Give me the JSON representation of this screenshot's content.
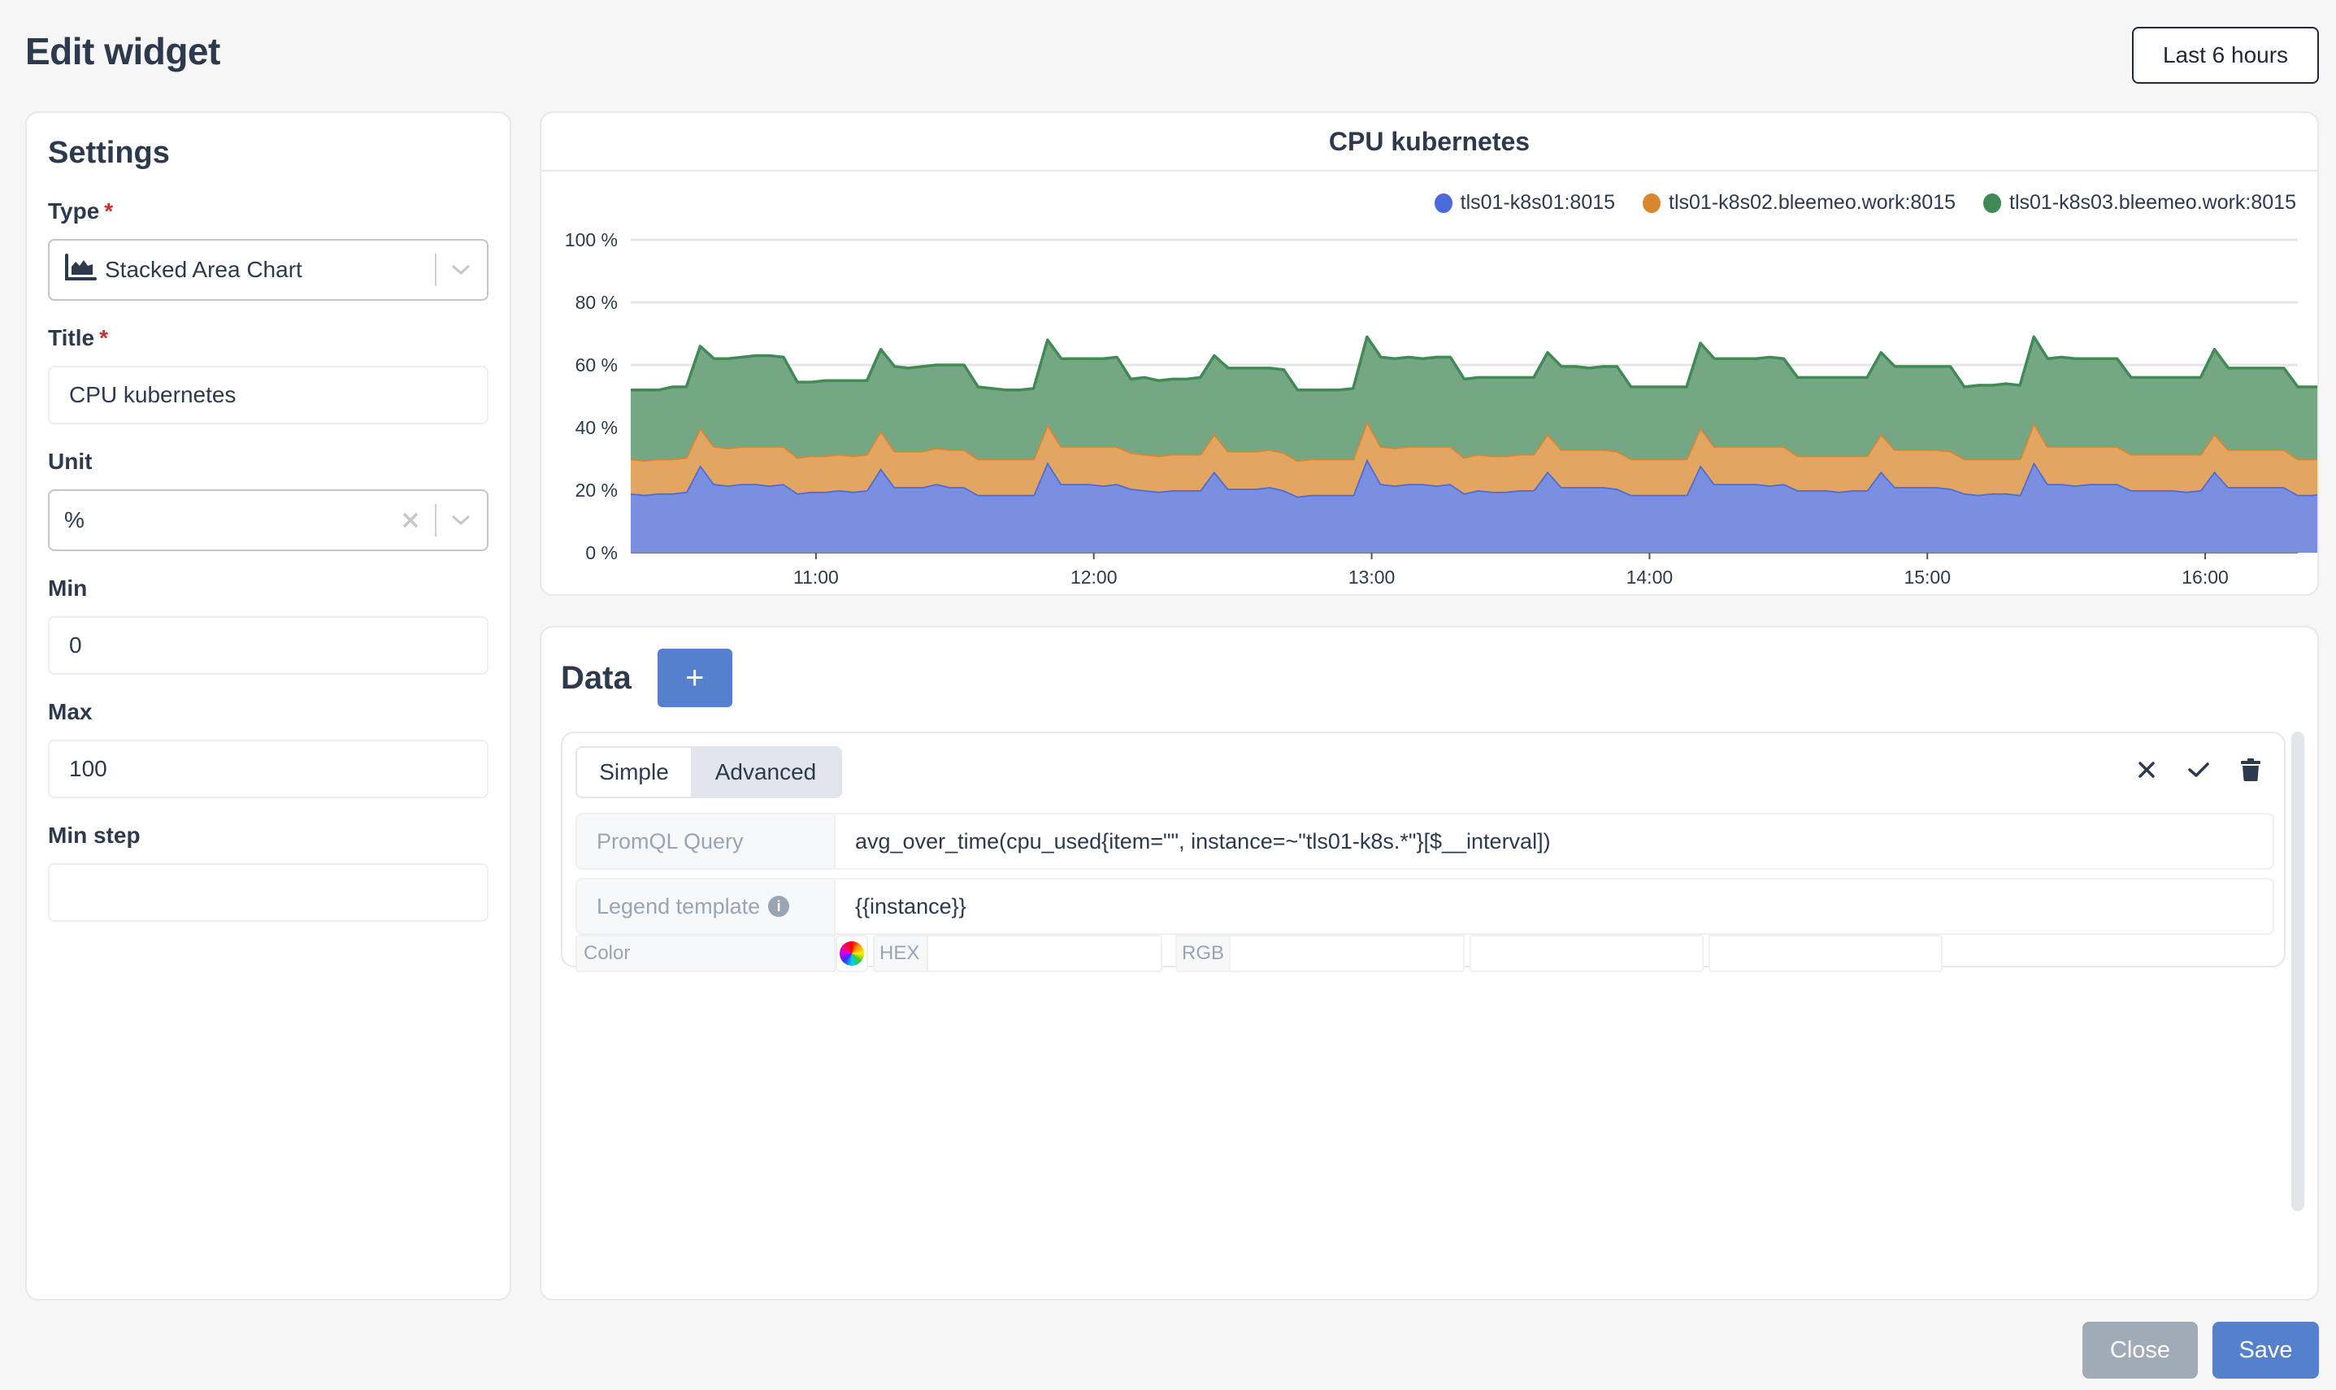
{
  "page": {
    "title": "Edit widget",
    "time_range": "Last 6 hours"
  },
  "settings": {
    "heading": "Settings",
    "type": {
      "label": "Type",
      "required_mark": "*",
      "value": "Stacked Area Chart",
      "icon": "area-chart-icon"
    },
    "title": {
      "label": "Title",
      "required_mark": "*",
      "value": "CPU kubernetes"
    },
    "unit": {
      "label": "Unit",
      "value": "%"
    },
    "min": {
      "label": "Min",
      "value": "0"
    },
    "max": {
      "label": "Max",
      "value": "100"
    },
    "min_step": {
      "label": "Min step",
      "value": ""
    }
  },
  "data_section": {
    "heading": "Data",
    "add_label": "+",
    "query": {
      "mode_simple": "Simple",
      "mode_advanced": "Advanced",
      "active_mode": "Advanced",
      "promql_label": "PromQL Query",
      "promql_value": "avg_over_time(cpu_used{item=\"\", instance=~\"tls01-k8s.*\"}[$__interval])",
      "legend_label": "Legend template",
      "legend_info_icon": "i",
      "legend_value": "{{instance}}",
      "color_label": "Color",
      "hex_label": "HEX",
      "hex_value": "",
      "rgb_label": "RGB",
      "rgb_r": "",
      "rgb_g": "",
      "rgb_b": "",
      "actions": [
        "close-icon",
        "check-icon",
        "trash-icon"
      ]
    }
  },
  "footer": {
    "close_label": "Close",
    "save_label": "Save"
  },
  "colors": {
    "accent": "#5580cc",
    "close_button": "#a0abb8",
    "required": "#c53030",
    "text": "#2d3a4e"
  },
  "chart_data": {
    "type": "area",
    "stacked": true,
    "title": "CPU kubernetes",
    "xlabel": "",
    "ylabel": "",
    "ylim": [
      0,
      100
    ],
    "yticks": [
      "0 %",
      "20 %",
      "40 %",
      "60 %",
      "80 %",
      "100 %"
    ],
    "ytick_values": [
      0,
      20,
      40,
      60,
      80,
      100
    ],
    "xticks": [
      "11:00",
      "12:00",
      "13:00",
      "14:00",
      "15:00",
      "16:00"
    ],
    "x_range": [
      "10:20",
      "16:20"
    ],
    "x_step_minutes": 3,
    "grid": true,
    "legend_position": "top-right",
    "series": [
      {
        "name": "tls01-k8s01:8015",
        "color": "#4a6bdb",
        "fill": "#7a8fdf",
        "values": [
          19,
          18.5,
          19,
          19,
          19.5,
          28,
          22,
          21.5,
          22,
          22,
          21.5,
          22,
          19,
          19.5,
          19.5,
          20,
          19.5,
          20,
          27,
          21,
          21,
          21,
          22,
          21,
          21,
          18.5,
          18.5,
          18.5,
          18.5,
          18.5,
          29,
          22,
          22,
          22,
          21.5,
          22,
          20.5,
          20,
          19.5,
          20,
          20,
          20,
          26,
          20.5,
          20.5,
          20.5,
          21,
          20,
          18,
          18.5,
          18.5,
          18.5,
          18.5,
          30,
          22,
          21.5,
          22,
          22,
          21.5,
          22,
          19,
          20,
          19.5,
          19.5,
          20,
          20,
          26,
          21,
          21,
          21,
          21,
          20.5,
          18.5,
          18.5,
          18.5,
          18.5,
          18.5,
          28,
          22,
          22,
          22,
          22,
          21.5,
          22,
          20,
          20,
          20,
          19.5,
          20,
          20,
          26,
          21,
          21,
          21,
          21,
          20.5,
          19,
          18.5,
          19,
          19,
          18.5,
          29,
          22,
          22,
          21.5,
          22,
          22,
          22,
          20,
          20,
          20,
          20,
          19.5,
          20,
          26,
          21,
          21,
          21,
          21,
          21,
          18.5,
          18.5,
          19,
          18.5,
          18.5,
          29,
          22,
          22,
          22,
          21.5,
          22,
          22,
          20,
          20,
          20,
          20,
          20,
          20,
          25,
          21,
          21,
          21,
          21,
          21,
          19,
          20
        ]
      },
      {
        "name": "tls01-k8s02.bleemeo.work:8015",
        "color": "#d9862e",
        "fill": "#e2a662",
        "values": [
          11,
          11,
          11,
          11,
          11,
          12,
          12,
          12,
          12,
          12,
          12.5,
          12,
          11.5,
          11.5,
          11.5,
          11.5,
          11.5,
          11.5,
          12,
          11.5,
          11.5,
          11.5,
          11.5,
          12,
          12,
          11.5,
          11.5,
          11.5,
          11.5,
          11.5,
          12,
          12,
          12,
          12,
          12.5,
          12,
          11.5,
          11.5,
          11.5,
          11.5,
          11.5,
          11.5,
          12,
          12,
          12,
          12,
          12,
          12,
          11.5,
          11.5,
          11.5,
          11.5,
          11.5,
          12,
          12,
          12,
          12,
          12,
          12.5,
          12,
          11.5,
          11.5,
          11.5,
          11.5,
          11.5,
          11.5,
          12,
          12,
          12,
          12,
          12,
          12,
          11.5,
          11.5,
          11.5,
          11.5,
          11.5,
          12,
          12,
          12,
          12,
          12,
          12.5,
          12,
          11,
          11,
          11,
          11.5,
          11,
          11,
          12,
          12,
          12,
          12,
          12,
          12,
          11,
          11.5,
          11,
          11,
          11.5,
          12.5,
          12,
          12,
          12.5,
          12,
          12,
          12,
          11.5,
          11.5,
          11.5,
          11.5,
          12,
          11.5,
          12,
          12,
          12,
          12,
          12,
          12,
          11.5,
          11.5,
          11,
          11.5,
          11.5,
          12,
          12,
          12,
          12,
          12.5,
          12,
          12,
          11,
          11,
          11,
          11,
          11,
          11,
          12,
          12,
          12,
          12,
          12,
          12,
          11,
          11
        ]
      },
      {
        "name": "tls01-k8s03.bleemeo.work:8015",
        "color": "#3f8a55",
        "fill": "#76a784",
        "values": [
          22,
          22.5,
          22,
          23,
          22.5,
          26,
          28,
          28.5,
          28.5,
          29,
          29,
          28.5,
          24,
          23.5,
          24,
          23.5,
          24,
          23.5,
          26,
          27,
          26.5,
          27,
          26.5,
          27,
          27,
          23,
          22.5,
          22,
          22,
          22.5,
          27,
          28,
          28,
          28,
          28,
          28.5,
          23.5,
          24.5,
          24,
          24,
          24,
          24.5,
          25,
          26.5,
          26.5,
          26.5,
          26,
          26.5,
          22.5,
          22,
          22,
          22,
          22.5,
          27,
          28.5,
          28.5,
          28.5,
          28,
          28.5,
          28.5,
          25,
          24.5,
          25,
          25,
          24.5,
          24.5,
          26,
          26.5,
          26.5,
          26,
          26.5,
          27,
          23,
          23,
          23,
          23,
          23,
          27,
          28,
          28,
          28,
          28,
          28.5,
          28,
          25,
          25,
          25,
          25,
          25,
          25,
          26,
          26.5,
          26.5,
          26.5,
          26.5,
          27,
          23,
          23.5,
          23.5,
          24,
          23.5,
          27.5,
          28,
          28.5,
          28,
          28,
          28,
          28,
          24.5,
          24.5,
          24.5,
          24.5,
          24.5,
          24.5,
          27,
          26,
          26,
          26,
          26,
          26,
          23,
          23,
          23,
          23,
          23,
          27,
          28,
          28,
          28,
          28,
          28,
          28,
          25,
          25,
          25,
          25,
          25,
          25,
          26,
          26,
          26,
          26,
          26,
          26,
          23,
          25
        ]
      }
    ]
  }
}
